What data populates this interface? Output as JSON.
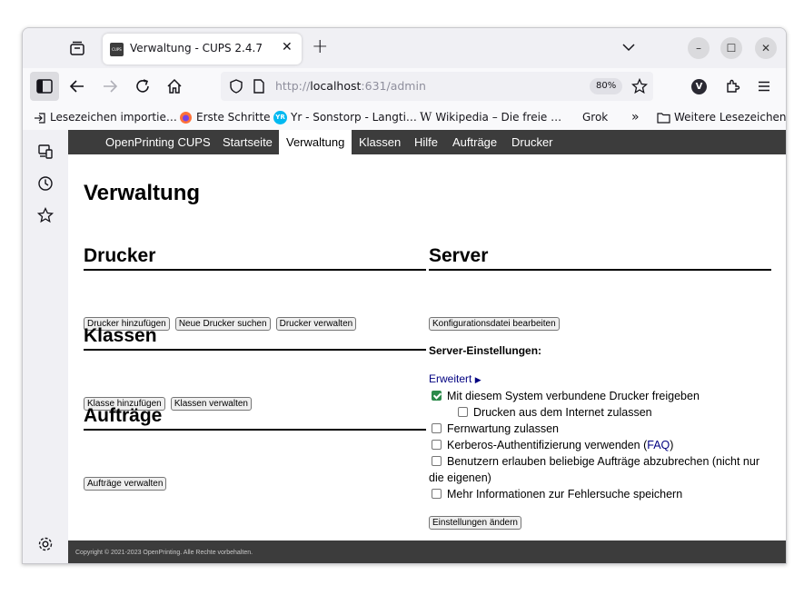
{
  "browser": {
    "tab_title": "Verwaltung - CUPS 2.4.7",
    "tab_favicon_text": "CUPS",
    "url_scheme": "http://",
    "url_host": "localhost",
    "url_path": ":631/admin",
    "zoom": "80%",
    "profile_initial": "V",
    "bookmarks": [
      {
        "label": "Lesezeichen importie…",
        "icon": "import-icon"
      },
      {
        "label": "Erste Schritte",
        "icon": "firefox-icon"
      },
      {
        "label": "Yr - Sonstorp - Langti…",
        "icon": "yr-icon"
      },
      {
        "label": "Wikipedia – Die freie …",
        "icon": "wikipedia-icon"
      },
      {
        "label": "Grok",
        "icon": "grok-icon"
      },
      {
        "label": "Weitere Lesezeichen",
        "icon": "folder-icon"
      }
    ],
    "yr_badge": "YR",
    "wiki_glyph": "W"
  },
  "cups": {
    "nav": [
      "OpenPrinting CUPS",
      "Startseite",
      "Verwaltung",
      "Klassen",
      "Hilfe",
      "Aufträge",
      "Drucker"
    ],
    "page_title": "Verwaltung",
    "drucker": {
      "heading": "Drucker",
      "buttons": [
        "Drucker hinzufügen",
        "Neue Drucker suchen",
        "Drucker verwalten"
      ]
    },
    "klassen": {
      "heading": "Klassen",
      "buttons": [
        "Klasse hinzufügen",
        "Klassen verwalten"
      ]
    },
    "auftraege": {
      "heading": "Aufträge",
      "buttons": [
        "Aufträge verwalten"
      ]
    },
    "server": {
      "heading": "Server",
      "config_button": "Konfigurationsdatei bearbeiten",
      "settings_label": "Server-Einstellungen:",
      "advanced_link": "Erweitert",
      "advanced_arrow": "▶",
      "options": [
        {
          "label": "Mit diesem System verbundene Drucker freigeben",
          "checked": true
        },
        {
          "label": "Drucken aus dem Internet zulassen",
          "checked": false
        },
        {
          "label": "Fernwartung zulassen",
          "checked": false
        },
        {
          "label": "Kerberos-Authentifizierung verwenden (",
          "checked": false
        },
        {
          "label": "Benutzern erlauben beliebige Aufträge abzubrechen (nicht nur",
          "checked": false
        },
        {
          "label": "Mehr Informationen zur Fehlersuche speichern",
          "checked": false
        }
      ],
      "faq_link": "FAQ",
      "faq_close": ")",
      "option5_wrap": "die eigenen)",
      "save_button": "Einstellungen ändern"
    },
    "footer": "Copyright © 2021-2023 OpenPrinting. Alle Rechte vorbehalten."
  }
}
